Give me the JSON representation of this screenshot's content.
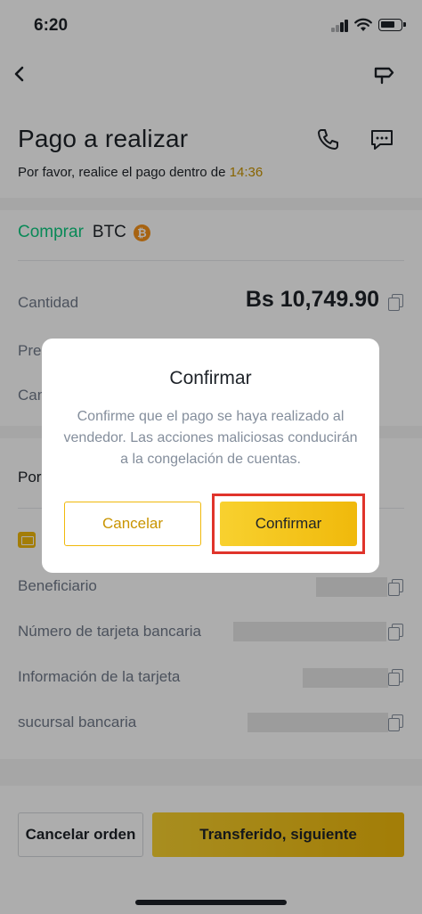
{
  "status_bar": {
    "time": "6:20"
  },
  "icons": {
    "back": "chevron-left-icon",
    "nav_right": "signpost-icon",
    "phone": "phone-icon",
    "chat": "chat-icon",
    "coin": "bitcoin-icon",
    "copy": "copy-icon",
    "card": "bank-card-icon"
  },
  "header": {
    "title": "Pago a realizar",
    "subtitle_prefix": "Por favor, realice el pago dentro de",
    "timer": "14:36"
  },
  "order": {
    "action_label": "Comprar",
    "coin": "BTC",
    "coin_symbol": "₿",
    "amount_label": "Cantidad",
    "amount_value": "Bs 10,749.90",
    "price_label_partial": "Pre",
    "quantity_label_partial": "Can",
    "payment_label_partial": "Por"
  },
  "payment_details": {
    "rows": [
      {
        "label": "Beneficiario"
      },
      {
        "label": "Número de tarjeta bancaria"
      },
      {
        "label": "Información de la tarjeta"
      },
      {
        "label": "sucursal bancaria"
      }
    ]
  },
  "footer": {
    "cancel_order_label": "Cancelar orden",
    "transferred_label": "Transferido, siguiente"
  },
  "modal": {
    "title": "Confirmar",
    "message": "Confirme que el pago se haya realizado al vendedor. Las acciones maliciosas conducirán a la congelación de cuentas.",
    "cancel_label": "Cancelar",
    "confirm_label": "Confirmar"
  },
  "colors": {
    "accent_yellow": "#f0b90b",
    "buy_green": "#0ecb81",
    "timer_gold": "#c99400",
    "highlight_red": "#e0342b"
  }
}
